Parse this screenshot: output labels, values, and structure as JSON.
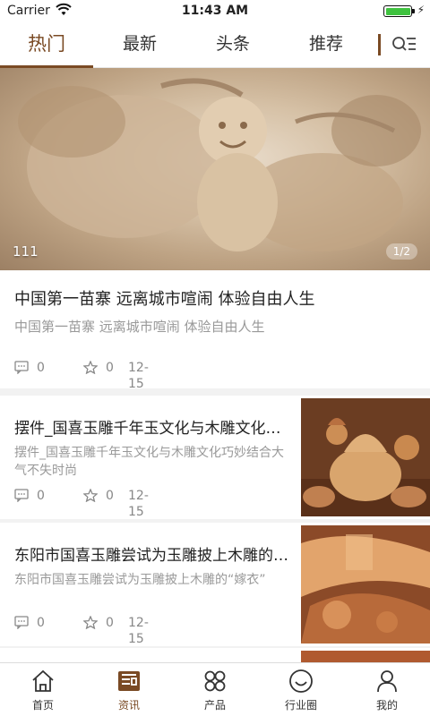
{
  "status_bar": {
    "carrier": "Carrier",
    "time": "11:43 AM"
  },
  "tabs": [
    {
      "label": "热门",
      "active": true
    },
    {
      "label": "最新",
      "active": false
    },
    {
      "label": "头条",
      "active": false
    },
    {
      "label": "推荐",
      "active": false
    }
  ],
  "banner": {
    "caption": "111",
    "pager": "1/2"
  },
  "featured": {
    "title": "中国第一苗寨 远离城市喧闹 体验自由人生",
    "summary": "中国第一苗寨 远离城市喧闹 体验自由人生",
    "comments": "0",
    "favorites": "0",
    "date": "12-15"
  },
  "articles": [
    {
      "title": "摆件_国喜玉雕千年玉文化与木雕文化巧妙结合大气不失时尚",
      "summary": "摆件_国喜玉雕千年玉文化与木雕文化巧妙结合大气不失时尚",
      "comments": "0",
      "favorites": "0",
      "date": "12-15"
    },
    {
      "title": "东阳市国喜玉雕尝试为玉雕披上木雕的“嫁衣”",
      "summary": "东阳市国喜玉雕尝试为玉雕披上木雕的“嫁衣”",
      "comments": "0",
      "favorites": "0",
      "date": "12-15"
    }
  ],
  "bottom_nav": [
    {
      "label": "首页",
      "icon": "home-icon",
      "active": false
    },
    {
      "label": "资讯",
      "icon": "news-icon",
      "active": true
    },
    {
      "label": "产品",
      "icon": "grid-icon",
      "active": false
    },
    {
      "label": "行业圈",
      "icon": "circle-icon",
      "active": false
    },
    {
      "label": "我的",
      "icon": "user-icon",
      "active": false
    }
  ],
  "colors": {
    "accent": "#7a4a24",
    "muted": "#999999",
    "battery": "#3fc23f"
  }
}
